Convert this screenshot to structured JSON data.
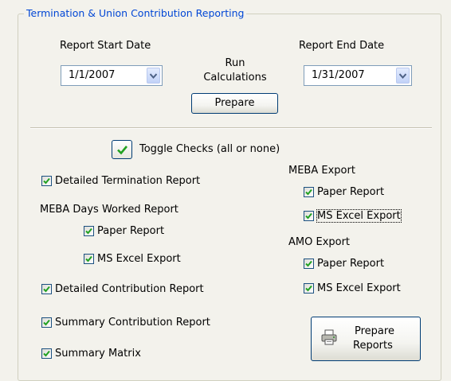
{
  "group_title": "Termination & Union Contribution Reporting",
  "report_start": {
    "label": "Report Start Date",
    "value": "1/1/2007"
  },
  "report_end": {
    "label": "Report End Date",
    "value": "1/31/2007"
  },
  "run_calculations": {
    "label_line1": "Run",
    "label_line2": "Calculations",
    "button": "Prepare"
  },
  "toggle_checks": {
    "label": "Toggle Checks (all or none)"
  },
  "left": {
    "detailed_termination": {
      "label": "Detailed Termination Report",
      "checked": true
    },
    "meba_days_worked": {
      "heading": "MEBA Days Worked Report",
      "paper": {
        "label": "Paper Report",
        "checked": true
      },
      "excel": {
        "label": "MS Excel Export",
        "checked": true
      }
    },
    "detailed_contribution": {
      "label": "Detailed Contribution  Report",
      "checked": true
    },
    "summary_contribution": {
      "label": "Summary Contribution  Report",
      "checked": true
    },
    "summary_matrix": {
      "label": "Summary Matrix",
      "checked": true
    }
  },
  "right": {
    "meba_export": {
      "heading": "MEBA Export",
      "paper": {
        "label": "Paper Report",
        "checked": true
      },
      "excel": {
        "label": "MS Excel Export",
        "checked": true
      }
    },
    "amo_export": {
      "heading": "AMO Export",
      "paper": {
        "label": "Paper Report",
        "checked": true
      },
      "excel": {
        "label": "MS Excel Export",
        "checked": true
      }
    }
  },
  "prepare_reports": {
    "line1": "Prepare",
    "line2": "Reports",
    "icon": "printer-icon"
  },
  "colors": {
    "legend": "#0046d5",
    "check": "#21a121",
    "background": "#f3f2ec"
  }
}
